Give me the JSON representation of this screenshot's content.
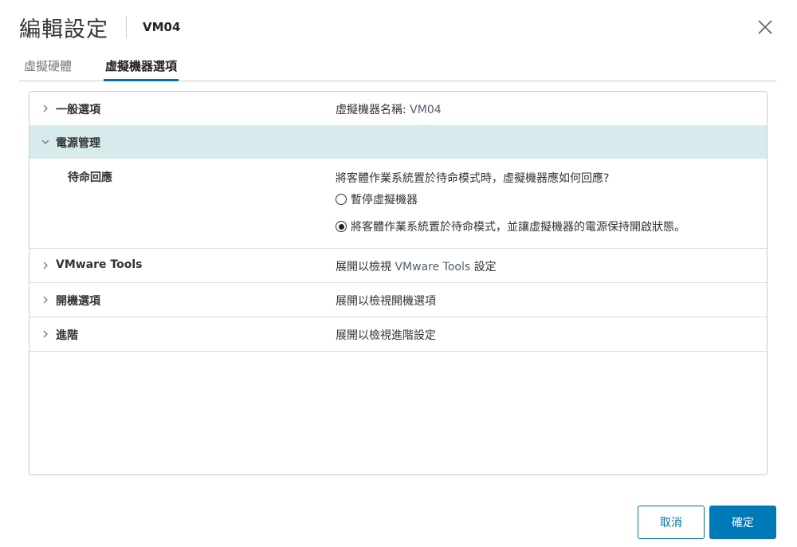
{
  "dialog": {
    "title": "編輯設定",
    "vm_name": "VM04"
  },
  "tabs": [
    {
      "label": "虛擬硬體",
      "active": false
    },
    {
      "label": "虛擬機器選項",
      "active": true
    }
  ],
  "sections": {
    "general": {
      "label": "一般選項",
      "value_prefix": "虛擬機器名稱: ",
      "value_highlight": "VM04"
    },
    "power": {
      "label": "電源管理",
      "standby": {
        "label": "待命回應",
        "question": "將客體作業系統置於待命模式時，虛擬機器應如何回應?",
        "options": [
          {
            "label": "暫停虛擬機器",
            "selected": false
          },
          {
            "label": "將客體作業系統置於待命模式，並讓虛擬機器的電源保持開啟狀態。",
            "selected": true
          }
        ]
      }
    },
    "vmware_tools": {
      "label": "VMware Tools",
      "value_prefix": "展開以檢視 ",
      "value_highlight": "VMware Tools",
      "value_suffix": " 設定"
    },
    "boot": {
      "label": "開機選項",
      "value": "展開以檢視開機選項"
    },
    "advanced": {
      "label": "進階",
      "value": "展開以檢視進階設定"
    }
  },
  "footer": {
    "cancel_label": "取消",
    "ok_label": "確定"
  },
  "colors": {
    "accent": "#0079b8",
    "expanded_row_bg": "#d7ebec",
    "border": "#cccccc"
  },
  "icons": [
    "close-icon",
    "chevron-right-icon",
    "chevron-down-icon",
    "radio-unchecked-icon",
    "radio-checked-icon"
  ]
}
